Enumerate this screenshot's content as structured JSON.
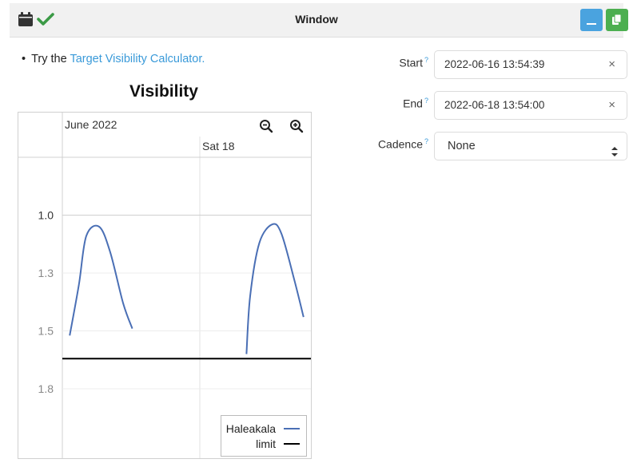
{
  "header": {
    "title": "Window"
  },
  "intro": {
    "prefix": "Try the ",
    "link_text": "Target Visibility Calculator."
  },
  "plot": {
    "title": "Visibility",
    "month_label": "June 2022",
    "day_label": "Sat 18",
    "y_ticks": [
      "1.0",
      "1.3",
      "1.5",
      "1.8"
    ],
    "legend": {
      "series": "Haleakala",
      "limit": "limit"
    },
    "colors": {
      "series": "#4a6fb5",
      "limit": "#000000"
    }
  },
  "chart_data": {
    "type": "line",
    "title": "Visibility",
    "x_labels": [
      "June 2022",
      "Sat 18"
    ],
    "y_tick_labels": [
      "1.0",
      "1.3",
      "1.5",
      "1.8"
    ],
    "y_axis_inverted": true,
    "ylim": [
      2.05,
      0.75
    ],
    "series": [
      {
        "name": "Haleakala",
        "segments": [
          [
            [
              0.04,
              1.52
            ],
            [
              0.09,
              1.3
            ],
            [
              0.13,
              1.09
            ],
            [
              0.2,
              1.05
            ],
            [
              0.26,
              1.16
            ],
            [
              0.33,
              1.38
            ],
            [
              0.38,
              1.49
            ]
          ],
          [
            [
              1.0,
              1.6
            ],
            [
              1.02,
              1.35
            ],
            [
              1.07,
              1.12
            ],
            [
              1.14,
              1.04
            ],
            [
              1.19,
              1.08
            ],
            [
              1.26,
              1.28
            ],
            [
              1.31,
              1.44
            ]
          ]
        ]
      },
      {
        "name": "limit",
        "constant": 1.62
      }
    ],
    "grid": true,
    "legend_position": "bottom-right"
  },
  "form": {
    "start": {
      "label": "Start",
      "help": "?",
      "value": "2022-06-16 13:54:39",
      "clear": "×"
    },
    "end": {
      "label": "End",
      "help": "?",
      "value": "2022-06-18 13:54:00",
      "clear": "×"
    },
    "cadence": {
      "label": "Cadence",
      "help": "?",
      "value": "None"
    }
  }
}
